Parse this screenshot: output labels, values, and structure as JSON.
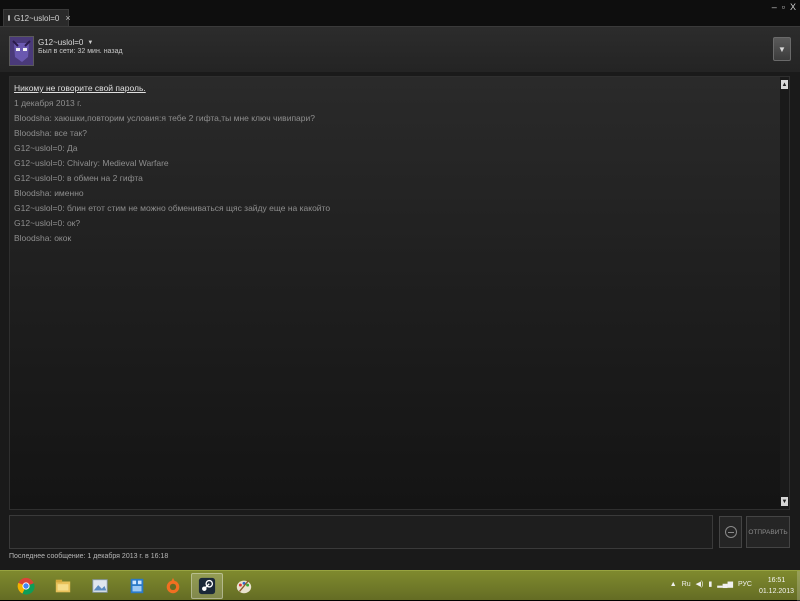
{
  "window": {
    "tab_title": "G12~uslol=0",
    "controls": {
      "minimize": "–",
      "maximize": "▫",
      "close": "X"
    }
  },
  "friend": {
    "name": "G12~uslol=0",
    "status": "Был в сети: 32 мин. назад",
    "menu_icon": "chevron-down-icon"
  },
  "chat": {
    "warning": "Никому не говорите свой пароль.",
    "date": "1 декабря 2013 г.",
    "messages": [
      {
        "author": "Bloodsha",
        "text": "хаюшки,повторим условия:я тебе 2 гифта,ты мне ключ чивипари?"
      },
      {
        "author": "Bloodsha",
        "text": "все так?"
      },
      {
        "author": "G12~uslol=0",
        "text": "Да"
      },
      {
        "author": "G12~uslol=0",
        "text": "Chivalry: Medieval Warfare"
      },
      {
        "author": "G12~uslol=0",
        "text": "в обмен на  2 гифта"
      },
      {
        "author": "Bloodsha",
        "text": "именно"
      },
      {
        "author": "G12~uslol=0",
        "text": "блин етот стим не можно обмениваться щяс зайду еще на какойто"
      },
      {
        "author": "G12~uslol=0",
        "text": "ок?"
      },
      {
        "author": "Bloodsha",
        "text": "окок"
      }
    ]
  },
  "composer": {
    "input_value": "",
    "send_label": "ОТПРАВИТЬ",
    "emoji_icon": "smiley-icon"
  },
  "footer": {
    "last_message": "Последнее сообщение: 1 декабря 2013 г. в 16:18"
  },
  "taskbar": {
    "apps": [
      "chrome-icon",
      "explorer-icon",
      "image-viewer-icon",
      "network-monitor-icon",
      "origin-icon",
      "steam-icon",
      "paint-icon"
    ],
    "active_app": "steam-icon",
    "tray": {
      "language": "РУС",
      "keyboard": "Ru"
    },
    "clock": {
      "time": "16:51",
      "date": "01.12.2013"
    }
  },
  "colors": {
    "window_bg": "#1a1a1a",
    "taskbar": "#737b29",
    "text_dim": "#8e8e8e"
  }
}
